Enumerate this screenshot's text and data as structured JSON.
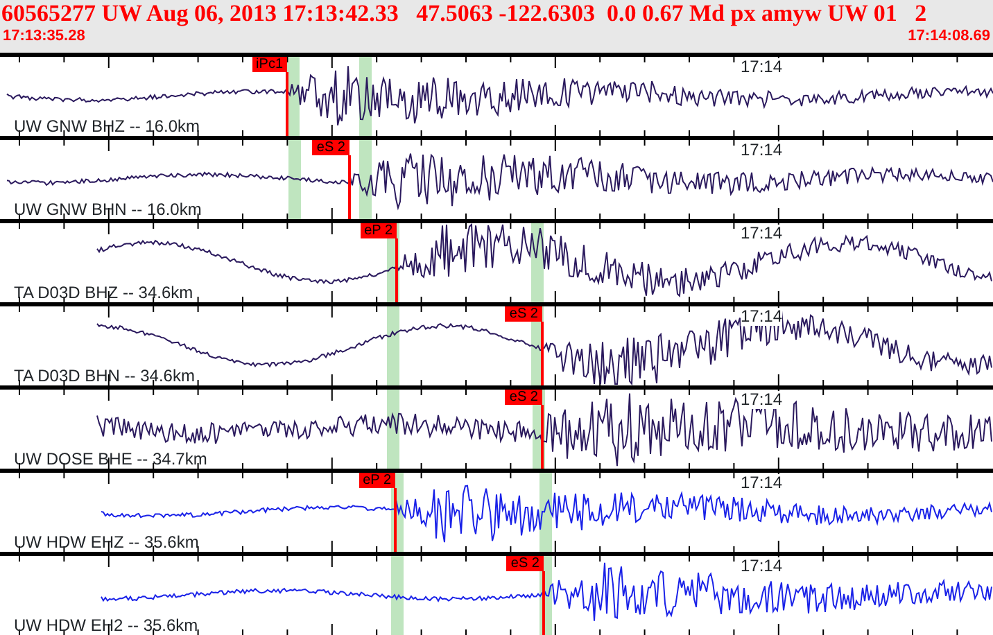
{
  "header": {
    "title": "60565277 UW Aug 06, 2013 17:13:42.33   47.5063 -122.6303  0.0 0.67 Md px amyw UW 01   2",
    "start_time": "17:13:35.28",
    "end_time": "17:14:08.69"
  },
  "traces": [
    {
      "label": "UW GNW BHZ -- 16.0km",
      "time_mark": "17:14",
      "color": "#2b1a5e",
      "picks": [
        {
          "label": "iPc1"
        }
      ]
    },
    {
      "label": "UW GNW BHN -- 16.0km",
      "time_mark": "17:14",
      "color": "#2b1a5e",
      "picks": [
        {
          "label": "eS 2"
        }
      ]
    },
    {
      "label": "TA D03D BHZ -- 34.6km",
      "time_mark": "17:14",
      "color": "#2b1a5e",
      "picks": [
        {
          "label": "eP 2"
        }
      ]
    },
    {
      "label": "TA D03D BHN -- 34.6km",
      "time_mark": "17:14",
      "color": "#2b1a5e",
      "picks": [
        {
          "label": "eS 2"
        }
      ]
    },
    {
      "label": "UW DOSE BHE -- 34.7km",
      "time_mark": "17:14",
      "color": "#2b1a5e",
      "picks": [
        {
          "label": "eS 2"
        }
      ]
    },
    {
      "label": "UW HDW EHZ -- 35.6km",
      "time_mark": "17:14",
      "color": "#1a22e8",
      "picks": [
        {
          "label": "eP 2"
        }
      ]
    },
    {
      "label": "UW HDW EH2 -- 35.6km",
      "time_mark": "17:14",
      "color": "#1a22e8",
      "picks": [
        {
          "label": "eS 2"
        }
      ]
    }
  ]
}
